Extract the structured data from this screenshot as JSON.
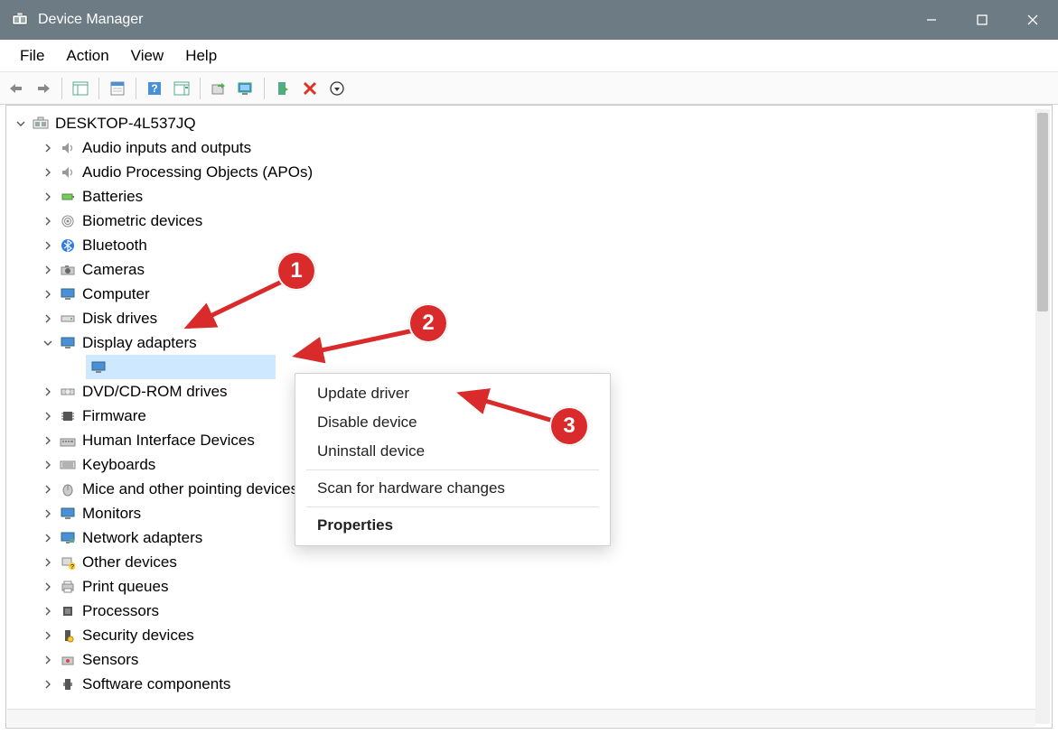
{
  "window": {
    "title": "Device Manager"
  },
  "menu": {
    "file": "File",
    "action": "Action",
    "view": "View",
    "help": "Help"
  },
  "toolbar": {
    "back_tip": "Back",
    "forward_tip": "Forward",
    "show_hide_console_tree_tip": "Show/Hide Console Tree",
    "properties_tip": "Properties",
    "help_tip": "Help",
    "action_tip": "Show Action Pane",
    "update_driver_tip": "Update Driver Software",
    "scan_hardware_tip": "Scan for hardware changes",
    "enable_tip": "Enable Device",
    "disable_tip": "Uninstall Device",
    "more_tip": "More"
  },
  "tree": {
    "root": "DESKTOP-4L537JQ",
    "items": [
      "Audio inputs and outputs",
      "Audio Processing Objects (APOs)",
      "Batteries",
      "Biometric devices",
      "Bluetooth",
      "Cameras",
      "Computer",
      "Disk drives",
      "Display adapters",
      "DVD/CD-ROM drives",
      "Firmware",
      "Human Interface Devices",
      "Keyboards",
      "Mice and other pointing devices",
      "Monitors",
      "Network adapters",
      "Other devices",
      "Print queues",
      "Processors",
      "Security devices",
      "Sensors",
      "Software components"
    ],
    "selected_child": ""
  },
  "contextmenu": {
    "update": "Update driver",
    "disable": "Disable device",
    "uninstall": "Uninstall device",
    "scan": "Scan for hardware changes",
    "properties": "Properties"
  },
  "annotations": {
    "b1": "1",
    "b2": "2",
    "b3": "3"
  }
}
